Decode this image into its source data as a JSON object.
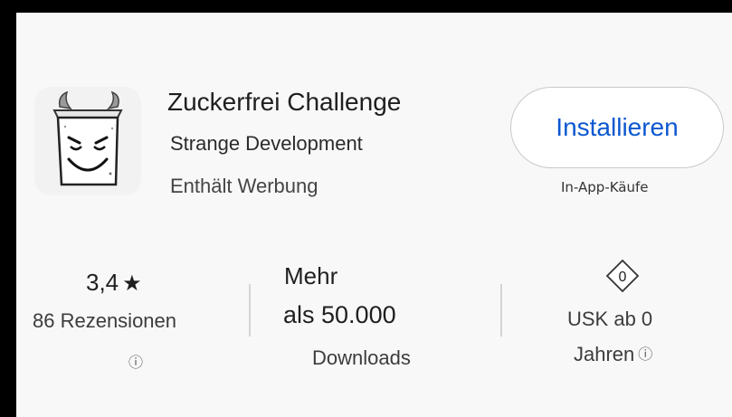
{
  "app": {
    "title": "Zuckerfrei Challenge",
    "developer": "Strange Development",
    "ads_notice": "Enthält Werbung",
    "icon": "sugar-cube-devil-icon"
  },
  "install": {
    "label": "Installieren",
    "iap_notice": "In-App-Käufe"
  },
  "stats": {
    "rating": {
      "value": "3,4",
      "star": "★",
      "reviews": "86 Rezensionen",
      "info": "ⓘ"
    },
    "downloads": {
      "line1": "Mehr",
      "line2": "als 50.000",
      "label": "Downloads"
    },
    "usk": {
      "badge": "0",
      "line1": "USK ab 0",
      "line2": "Jahren",
      "info": "ⓘ"
    }
  },
  "colors": {
    "accent": "#0b57d0",
    "background": "#f8f8f8",
    "frame": "#000000"
  }
}
